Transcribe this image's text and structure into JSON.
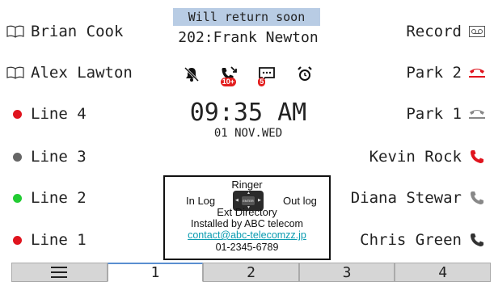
{
  "left_keys": [
    {
      "label": "Brian Cook",
      "icon": "book-icon"
    },
    {
      "label": "Alex Lawton",
      "icon": "book-icon"
    },
    {
      "label": "Line 4",
      "icon": "line-status-dot",
      "color": "#e0141e"
    },
    {
      "label": "Line 3",
      "icon": "line-status-dot",
      "color": "#666666"
    },
    {
      "label": "Line 2",
      "icon": "line-status-dot",
      "color": "#22cc33"
    },
    {
      "label": "Line 1",
      "icon": "line-status-dot",
      "color": "#e0141e"
    }
  ],
  "right_keys": [
    {
      "label": "Record",
      "icon": "voicemail-icon"
    },
    {
      "label": "Park 2",
      "icon": "parked-call-icon",
      "color": "#e0141e"
    },
    {
      "label": "Park 1",
      "icon": "parked-call-icon",
      "color": "#888888"
    },
    {
      "label": "Kevin Rock",
      "icon": "phone-icon",
      "color": "#e0141e"
    },
    {
      "label": "Diana Stewar",
      "icon": "phone-icon",
      "color": "#888888"
    },
    {
      "label": "Chris Green",
      "icon": "phone-icon",
      "color": "#333333"
    }
  ],
  "status": {
    "banner": "Will return soon",
    "user_line": "202:Frank Newton",
    "icons": [
      {
        "name": "bell-muted-icon"
      },
      {
        "name": "missed-call-icon",
        "badge": "10+"
      },
      {
        "name": "message-icon",
        "badge": "5"
      },
      {
        "name": "alarm-clock-icon"
      }
    ]
  },
  "clock": {
    "time": "09:35 AM",
    "date": "01 NOV.WED"
  },
  "help": {
    "up": "Ringer",
    "left": "In Log",
    "right": "Out log",
    "down": "Ext Directory",
    "enter": "ENTER",
    "installed_by": "Installed by ABC telecom",
    "email": "contact@abc-telecomzz.jp",
    "phone": "01-2345-6789"
  },
  "tabs": [
    {
      "label": "",
      "icon": "menu-icon"
    },
    {
      "label": "1",
      "active": true
    },
    {
      "label": "2"
    },
    {
      "label": "3"
    },
    {
      "label": "4"
    }
  ],
  "colors": {
    "banner": "#b8cce4",
    "tab_inactive": "#d6d6d6",
    "accent_red": "#e0141e"
  }
}
